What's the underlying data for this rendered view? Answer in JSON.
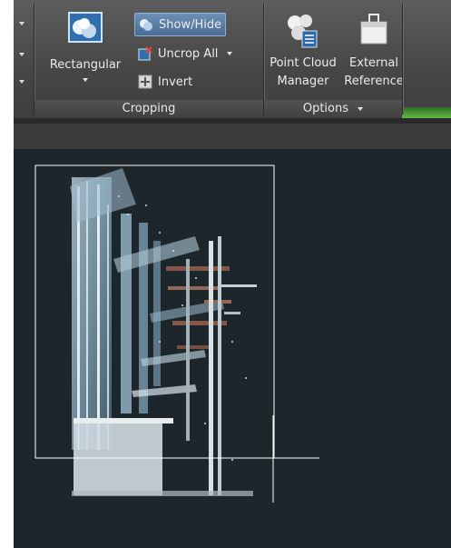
{
  "ribbon": {
    "cropping_panel": {
      "title": "Cropping",
      "rectangular_label": "Rectangular",
      "show_hide_label": "Show/Hide",
      "uncrop_all_label": "Uncrop All",
      "invert_label": "Invert"
    },
    "options_panel": {
      "title": "Options",
      "point_cloud_manager_line1": "Point Cloud",
      "point_cloud_manager_line2": "Manager",
      "external_reference_line1": "External",
      "external_reference_line2": "Reference"
    }
  },
  "icons": [
    "rectangular-crop-icon",
    "show-hide-icon",
    "uncrop-all-icon",
    "invert-icon",
    "point-cloud-manager-icon",
    "external-reference-icon",
    "chevron-down-icon"
  ],
  "colors": {
    "ribbon": "#464646",
    "active_button": "#5a7ea6",
    "viewport_background": "#1d262b",
    "crop_boundary": "#ffffff",
    "ribbon_accent": "#65b842"
  }
}
